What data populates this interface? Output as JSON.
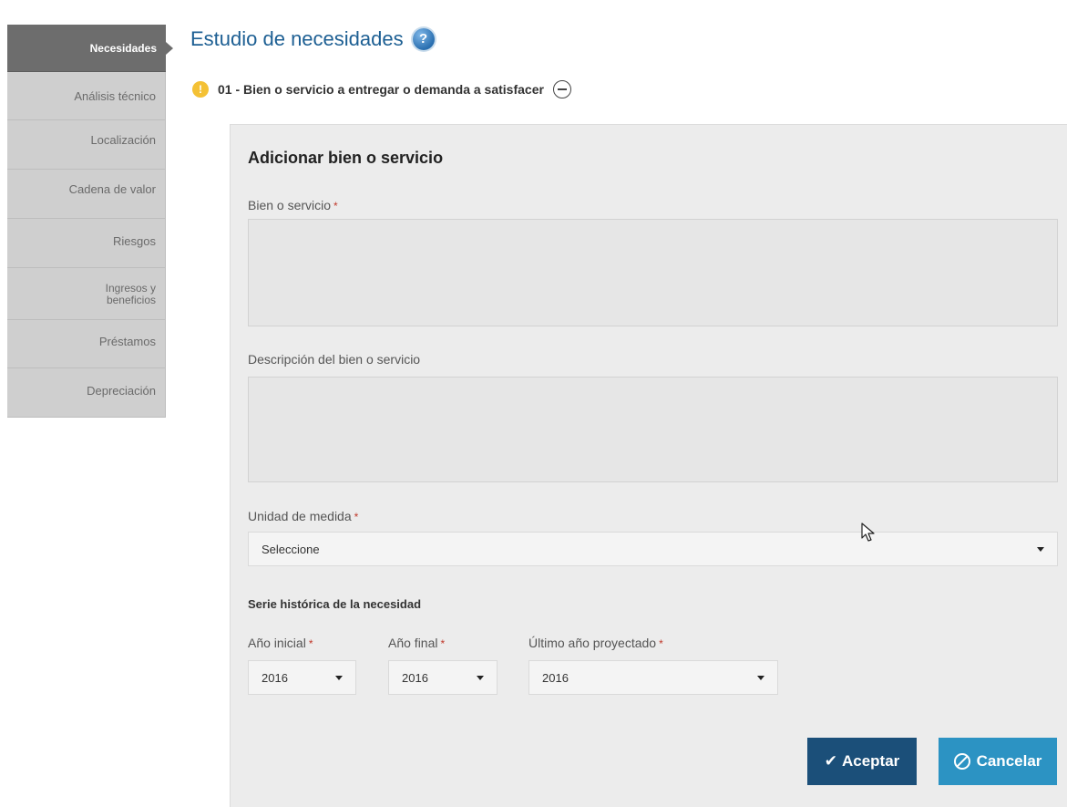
{
  "sidebar": {
    "items": [
      {
        "label": "Necesidades",
        "active": true
      },
      {
        "label": "Análisis técnico"
      },
      {
        "label": "Localización"
      },
      {
        "label": "Cadena de valor"
      },
      {
        "label": "Riesgos"
      },
      {
        "label": "Ingresos y beneficios"
      },
      {
        "label": "Préstamos"
      },
      {
        "label": "Depreciación"
      }
    ]
  },
  "header": {
    "title": "Estudio de necesidades",
    "help_icon": "question-icon",
    "help_symbol": "?"
  },
  "section": {
    "warning_symbol": "!",
    "title": "01 - Bien o servicio a entregar o demanda a satisfacer"
  },
  "form": {
    "title": "Adicionar bien o servicio",
    "required_marker": "*",
    "bien_label": "Bien o servicio",
    "bien_value": "",
    "descripcion_label": "Descripción del bien o servicio",
    "descripcion_value": "",
    "unidad_label": "Unidad de medida",
    "unidad_value": "Seleccione",
    "serie_heading": "Serie histórica de la necesidad",
    "anio_inicial_label": "Año inicial",
    "anio_inicial_value": "2016",
    "anio_final_label": "Año final",
    "anio_final_value": "2016",
    "ultimo_anio_label": "Último año proyectado",
    "ultimo_anio_value": "2016",
    "accept_label": "Aceptar",
    "cancel_label": "Cancelar"
  },
  "colors": {
    "title_blue": "#1d5f93",
    "accept_bg": "#1b4f79",
    "cancel_bg": "#2c93c3",
    "sidebar_active": "#6d6d6d",
    "sidebar_inactive": "#cfcfcf"
  }
}
